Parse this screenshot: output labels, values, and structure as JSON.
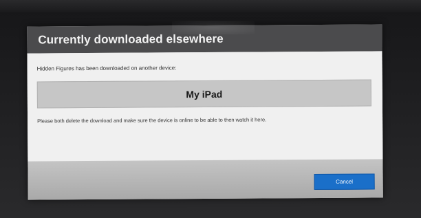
{
  "dialog": {
    "title": "Currently downloaded elsewhere",
    "intro": "Hidden Figures has been downloaded on another device:",
    "device_name": "My iPad",
    "instruction": "Please both delete the download and make sure the device is online to be able to then watch it here.",
    "cancel_label": "Cancel"
  },
  "colors": {
    "header_bg": "#4b4b4d",
    "device_box_bg": "#c6c6c6",
    "cancel_button_bg": "#1a6fc9"
  }
}
